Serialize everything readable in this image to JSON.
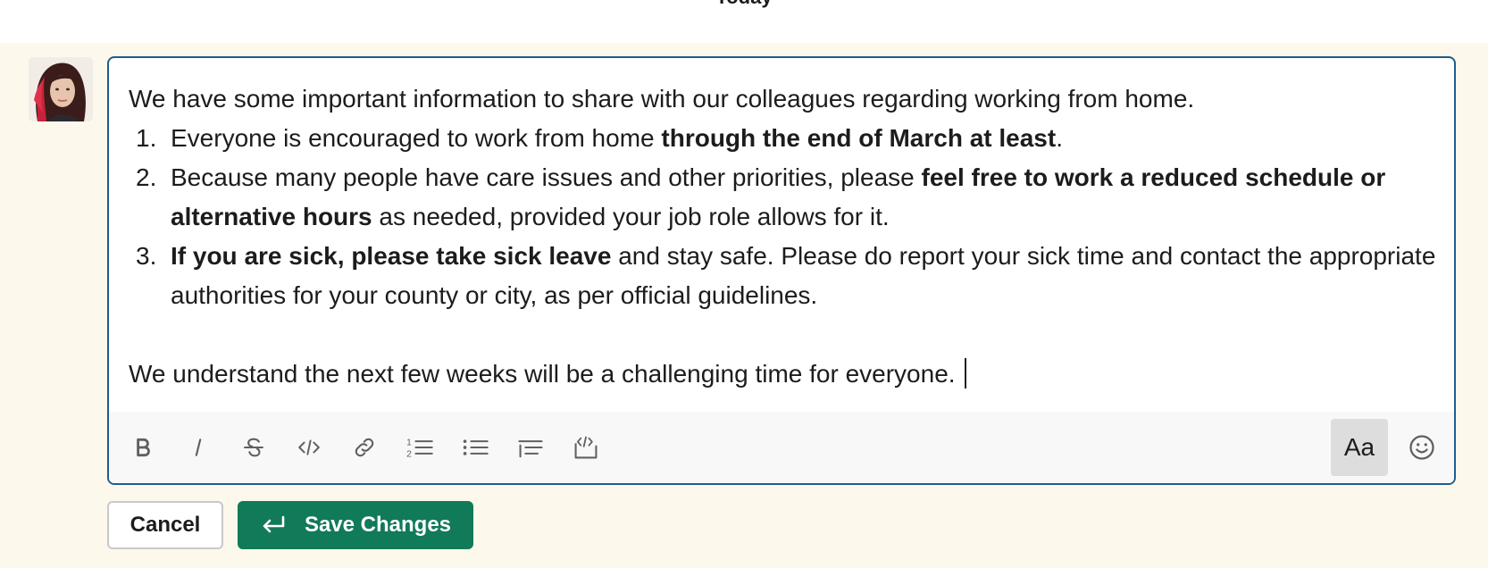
{
  "day_divider": {
    "label": "Today"
  },
  "composer": {
    "intro": "We have some important information to share with our colleagues regarding working from home.",
    "list": [
      {
        "number": "1.",
        "parts": [
          {
            "text": "Everyone is encouraged to work from home ",
            "bold": false
          },
          {
            "text": "through the end of March at least",
            "bold": true
          },
          {
            "text": ".",
            "bold": false
          }
        ]
      },
      {
        "number": "2.",
        "parts": [
          {
            "text": "Because many people have care issues and other priorities, please ",
            "bold": false
          },
          {
            "text": "feel free to work a reduced schedule or alternative hours",
            "bold": true
          },
          {
            "text": " as needed, provided your job role allows for it.",
            "bold": false
          }
        ]
      },
      {
        "number": "3.",
        "parts": [
          {
            "text": "If you are sick, please take sick leave",
            "bold": true
          },
          {
            "text": " and stay safe. Please do report your sick time and contact the appropriate authorities for your county or city, as per official guidelines.",
            "bold": false
          }
        ]
      }
    ],
    "closing": "We understand the next few weeks will be a challenging time for everyone."
  },
  "toolbar": {
    "buttons": [
      "bold-icon",
      "italic-icon",
      "strikethrough-icon",
      "code-icon",
      "link-icon",
      "ordered-list-icon",
      "bulleted-list-icon",
      "blockquote-icon",
      "code-block-icon"
    ],
    "format_toggle_label": "Aa",
    "emoji_icon": "emoji-icon"
  },
  "actions": {
    "cancel_label": "Cancel",
    "save_label": "Save Changes",
    "save_icon": "enter-icon"
  },
  "colors": {
    "composer_border": "#1f5d8e",
    "save_button": "#117a58",
    "row_highlight": "#fdf8ec"
  }
}
